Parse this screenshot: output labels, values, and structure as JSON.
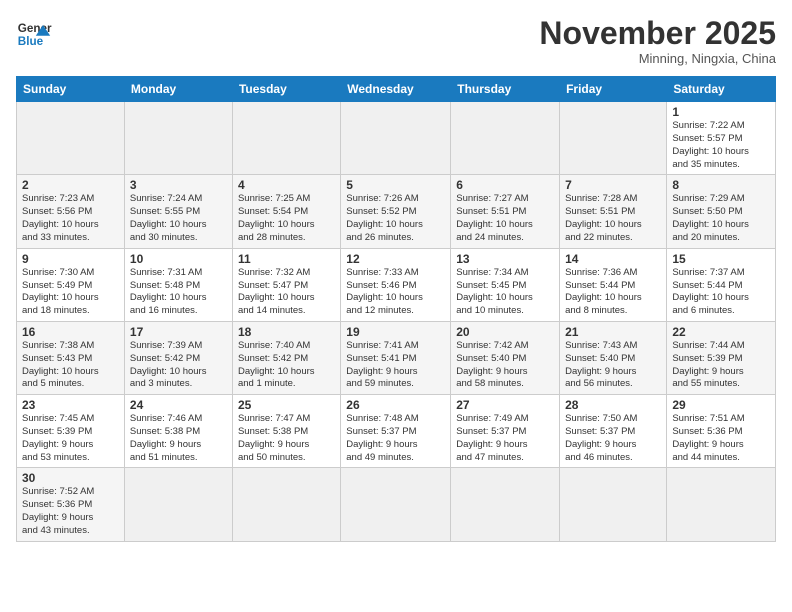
{
  "logo": {
    "line1": "General",
    "line2": "Blue"
  },
  "title": "November 2025",
  "subtitle": "Minning, Ningxia, China",
  "weekdays": [
    "Sunday",
    "Monday",
    "Tuesday",
    "Wednesday",
    "Thursday",
    "Friday",
    "Saturday"
  ],
  "weeks": [
    [
      {
        "day": "",
        "info": ""
      },
      {
        "day": "",
        "info": ""
      },
      {
        "day": "",
        "info": ""
      },
      {
        "day": "",
        "info": ""
      },
      {
        "day": "",
        "info": ""
      },
      {
        "day": "",
        "info": ""
      },
      {
        "day": "1",
        "info": "Sunrise: 7:22 AM\nSunset: 5:57 PM\nDaylight: 10 hours\nand 35 minutes."
      }
    ],
    [
      {
        "day": "2",
        "info": "Sunrise: 7:23 AM\nSunset: 5:56 PM\nDaylight: 10 hours\nand 33 minutes."
      },
      {
        "day": "3",
        "info": "Sunrise: 7:24 AM\nSunset: 5:55 PM\nDaylight: 10 hours\nand 30 minutes."
      },
      {
        "day": "4",
        "info": "Sunrise: 7:25 AM\nSunset: 5:54 PM\nDaylight: 10 hours\nand 28 minutes."
      },
      {
        "day": "5",
        "info": "Sunrise: 7:26 AM\nSunset: 5:52 PM\nDaylight: 10 hours\nand 26 minutes."
      },
      {
        "day": "6",
        "info": "Sunrise: 7:27 AM\nSunset: 5:51 PM\nDaylight: 10 hours\nand 24 minutes."
      },
      {
        "day": "7",
        "info": "Sunrise: 7:28 AM\nSunset: 5:51 PM\nDaylight: 10 hours\nand 22 minutes."
      },
      {
        "day": "8",
        "info": "Sunrise: 7:29 AM\nSunset: 5:50 PM\nDaylight: 10 hours\nand 20 minutes."
      }
    ],
    [
      {
        "day": "9",
        "info": "Sunrise: 7:30 AM\nSunset: 5:49 PM\nDaylight: 10 hours\nand 18 minutes."
      },
      {
        "day": "10",
        "info": "Sunrise: 7:31 AM\nSunset: 5:48 PM\nDaylight: 10 hours\nand 16 minutes."
      },
      {
        "day": "11",
        "info": "Sunrise: 7:32 AM\nSunset: 5:47 PM\nDaylight: 10 hours\nand 14 minutes."
      },
      {
        "day": "12",
        "info": "Sunrise: 7:33 AM\nSunset: 5:46 PM\nDaylight: 10 hours\nand 12 minutes."
      },
      {
        "day": "13",
        "info": "Sunrise: 7:34 AM\nSunset: 5:45 PM\nDaylight: 10 hours\nand 10 minutes."
      },
      {
        "day": "14",
        "info": "Sunrise: 7:36 AM\nSunset: 5:44 PM\nDaylight: 10 hours\nand 8 minutes."
      },
      {
        "day": "15",
        "info": "Sunrise: 7:37 AM\nSunset: 5:44 PM\nDaylight: 10 hours\nand 6 minutes."
      }
    ],
    [
      {
        "day": "16",
        "info": "Sunrise: 7:38 AM\nSunset: 5:43 PM\nDaylight: 10 hours\nand 5 minutes."
      },
      {
        "day": "17",
        "info": "Sunrise: 7:39 AM\nSunset: 5:42 PM\nDaylight: 10 hours\nand 3 minutes."
      },
      {
        "day": "18",
        "info": "Sunrise: 7:40 AM\nSunset: 5:42 PM\nDaylight: 10 hours\nand 1 minute."
      },
      {
        "day": "19",
        "info": "Sunrise: 7:41 AM\nSunset: 5:41 PM\nDaylight: 9 hours\nand 59 minutes."
      },
      {
        "day": "20",
        "info": "Sunrise: 7:42 AM\nSunset: 5:40 PM\nDaylight: 9 hours\nand 58 minutes."
      },
      {
        "day": "21",
        "info": "Sunrise: 7:43 AM\nSunset: 5:40 PM\nDaylight: 9 hours\nand 56 minutes."
      },
      {
        "day": "22",
        "info": "Sunrise: 7:44 AM\nSunset: 5:39 PM\nDaylight: 9 hours\nand 55 minutes."
      }
    ],
    [
      {
        "day": "23",
        "info": "Sunrise: 7:45 AM\nSunset: 5:39 PM\nDaylight: 9 hours\nand 53 minutes."
      },
      {
        "day": "24",
        "info": "Sunrise: 7:46 AM\nSunset: 5:38 PM\nDaylight: 9 hours\nand 51 minutes."
      },
      {
        "day": "25",
        "info": "Sunrise: 7:47 AM\nSunset: 5:38 PM\nDaylight: 9 hours\nand 50 minutes."
      },
      {
        "day": "26",
        "info": "Sunrise: 7:48 AM\nSunset: 5:37 PM\nDaylight: 9 hours\nand 49 minutes."
      },
      {
        "day": "27",
        "info": "Sunrise: 7:49 AM\nSunset: 5:37 PM\nDaylight: 9 hours\nand 47 minutes."
      },
      {
        "day": "28",
        "info": "Sunrise: 7:50 AM\nSunset: 5:37 PM\nDaylight: 9 hours\nand 46 minutes."
      },
      {
        "day": "29",
        "info": "Sunrise: 7:51 AM\nSunset: 5:36 PM\nDaylight: 9 hours\nand 44 minutes."
      }
    ],
    [
      {
        "day": "30",
        "info": "Sunrise: 7:52 AM\nSunset: 5:36 PM\nDaylight: 9 hours\nand 43 minutes."
      },
      {
        "day": "",
        "info": ""
      },
      {
        "day": "",
        "info": ""
      },
      {
        "day": "",
        "info": ""
      },
      {
        "day": "",
        "info": ""
      },
      {
        "day": "",
        "info": ""
      },
      {
        "day": "",
        "info": ""
      }
    ]
  ]
}
